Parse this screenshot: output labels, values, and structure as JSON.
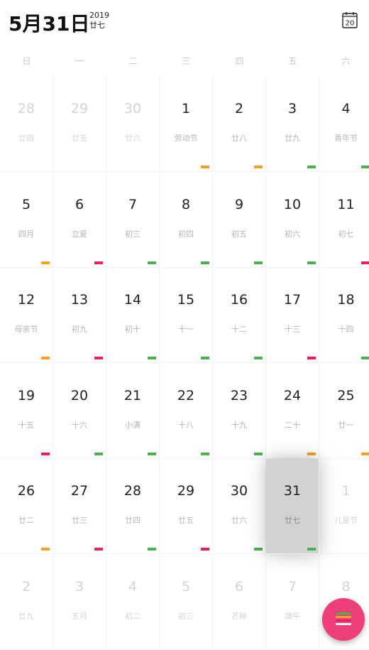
{
  "header": {
    "big_date": "5月31日",
    "year": "2019",
    "lunar": "廿七",
    "calendar_icon_day": "20"
  },
  "weekdays": [
    "日",
    "一",
    "二",
    "三",
    "四",
    "五",
    "六"
  ],
  "colors": {
    "orange": "#f5a01f",
    "green": "#4caf50",
    "pink": "#e91e63",
    "fab": "#ef3f7a"
  },
  "weeks": [
    [
      {
        "day": "28",
        "sub": "廿四",
        "other": true,
        "mark": null
      },
      {
        "day": "29",
        "sub": "廿五",
        "other": true,
        "mark": null
      },
      {
        "day": "30",
        "sub": "廿六",
        "other": true,
        "mark": null
      },
      {
        "day": "1",
        "sub": "劳动节",
        "other": false,
        "mark": "orange"
      },
      {
        "day": "2",
        "sub": "廿八",
        "other": false,
        "mark": "orange"
      },
      {
        "day": "3",
        "sub": "廿九",
        "other": false,
        "mark": "green"
      },
      {
        "day": "4",
        "sub": "青年节",
        "other": false,
        "mark": "green"
      }
    ],
    [
      {
        "day": "5",
        "sub": "四月",
        "other": false,
        "mark": "orange"
      },
      {
        "day": "6",
        "sub": "立夏",
        "other": false,
        "mark": "pink"
      },
      {
        "day": "7",
        "sub": "初三",
        "other": false,
        "mark": "green"
      },
      {
        "day": "8",
        "sub": "初四",
        "other": false,
        "mark": "green"
      },
      {
        "day": "9",
        "sub": "初五",
        "other": false,
        "mark": "green"
      },
      {
        "day": "10",
        "sub": "初六",
        "other": false,
        "mark": "green"
      },
      {
        "day": "11",
        "sub": "初七",
        "other": false,
        "mark": "pink"
      }
    ],
    [
      {
        "day": "12",
        "sub": "母亲节",
        "other": false,
        "mark": "orange"
      },
      {
        "day": "13",
        "sub": "初九",
        "other": false,
        "mark": "pink"
      },
      {
        "day": "14",
        "sub": "初十",
        "other": false,
        "mark": "green"
      },
      {
        "day": "15",
        "sub": "十一",
        "other": false,
        "mark": "green"
      },
      {
        "day": "16",
        "sub": "十二",
        "other": false,
        "mark": "green"
      },
      {
        "day": "17",
        "sub": "十三",
        "other": false,
        "mark": "pink"
      },
      {
        "day": "18",
        "sub": "十四",
        "other": false,
        "mark": "green"
      }
    ],
    [
      {
        "day": "19",
        "sub": "十五",
        "other": false,
        "mark": "pink"
      },
      {
        "day": "20",
        "sub": "十六",
        "other": false,
        "mark": "green"
      },
      {
        "day": "21",
        "sub": "小满",
        "other": false,
        "mark": "green"
      },
      {
        "day": "22",
        "sub": "十八",
        "other": false,
        "mark": "green"
      },
      {
        "day": "23",
        "sub": "十九",
        "other": false,
        "mark": "green"
      },
      {
        "day": "24",
        "sub": "二十",
        "other": false,
        "mark": "orange"
      },
      {
        "day": "25",
        "sub": "廿一",
        "other": false,
        "mark": "orange"
      }
    ],
    [
      {
        "day": "26",
        "sub": "廿二",
        "other": false,
        "mark": "orange"
      },
      {
        "day": "27",
        "sub": "廿三",
        "other": false,
        "mark": "pink"
      },
      {
        "day": "28",
        "sub": "廿四",
        "other": false,
        "mark": "green"
      },
      {
        "day": "29",
        "sub": "廿五",
        "other": false,
        "mark": "pink"
      },
      {
        "day": "30",
        "sub": "廿六",
        "other": false,
        "mark": "green"
      },
      {
        "day": "31",
        "sub": "廿七",
        "other": false,
        "mark": "green",
        "selected": true
      },
      {
        "day": "1",
        "sub": "儿童节",
        "other": true,
        "mark": null
      }
    ],
    [
      {
        "day": "2",
        "sub": "廿九",
        "other": true,
        "mark": null
      },
      {
        "day": "3",
        "sub": "五月",
        "other": true,
        "mark": null
      },
      {
        "day": "4",
        "sub": "初二",
        "other": true,
        "mark": null
      },
      {
        "day": "5",
        "sub": "初三",
        "other": true,
        "mark": null
      },
      {
        "day": "6",
        "sub": "芒种",
        "other": true,
        "mark": null
      },
      {
        "day": "7",
        "sub": "端午",
        "other": true,
        "mark": null
      },
      {
        "day": "8",
        "sub": "",
        "other": true,
        "mark": null
      }
    ]
  ],
  "fab": {
    "icon": "menu-layers-icon",
    "bar_colors": [
      "#4caf50",
      "#f5a01f",
      "#e91e63",
      "#ffffff"
    ]
  }
}
